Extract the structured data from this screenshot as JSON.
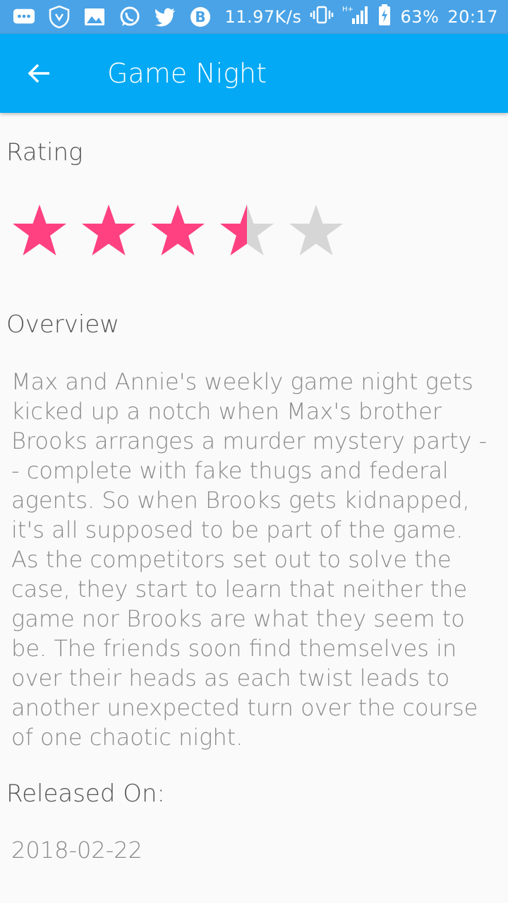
{
  "status_bar": {
    "network_speed": "11.97K/s",
    "battery": "63%",
    "time": "20:17",
    "icons": [
      "chat-icon",
      "shield-icon",
      "image-icon",
      "whatsapp-icon",
      "twitter-icon",
      "b-app-icon",
      "vibrate-icon",
      "signal-icon",
      "battery-icon"
    ]
  },
  "app_bar": {
    "title": "Game Night",
    "back_icon": "arrow-back-icon"
  },
  "rating": {
    "label": "Rating",
    "value": 3.5,
    "max": 5,
    "filled_color": "#ff4081",
    "empty_color": "#d6d6d6"
  },
  "overview": {
    "label": "Overview",
    "text": "Max and Annie's weekly game night gets kicked up a notch when Max's brother Brooks arranges a murder mystery party -- complete with fake thugs and federal agents. So when Brooks gets kidnapped, it's all supposed to be part of the game. As the competitors set out to solve the case, they start to learn that neither the game nor Brooks are what they seem to be. The friends soon find themselves in over their heads as each twist leads to another unexpected turn over the course of one chaotic night."
  },
  "release": {
    "label": "Released On:",
    "date": "2018-02-22"
  }
}
